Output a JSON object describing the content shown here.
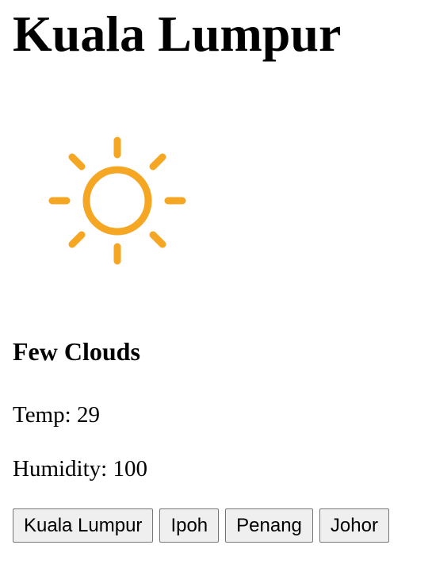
{
  "city": {
    "name": "Kuala Lumpur"
  },
  "weather": {
    "icon": "sun-icon",
    "icon_color": "#F5A623",
    "condition": "Few Clouds",
    "temp_label": "Temp:",
    "temp_value": "29",
    "humidity_label": "Humidity:",
    "humidity_value": "100"
  },
  "city_buttons": [
    {
      "label": "Kuala Lumpur"
    },
    {
      "label": "Ipoh"
    },
    {
      "label": "Penang"
    },
    {
      "label": "Johor"
    }
  ]
}
